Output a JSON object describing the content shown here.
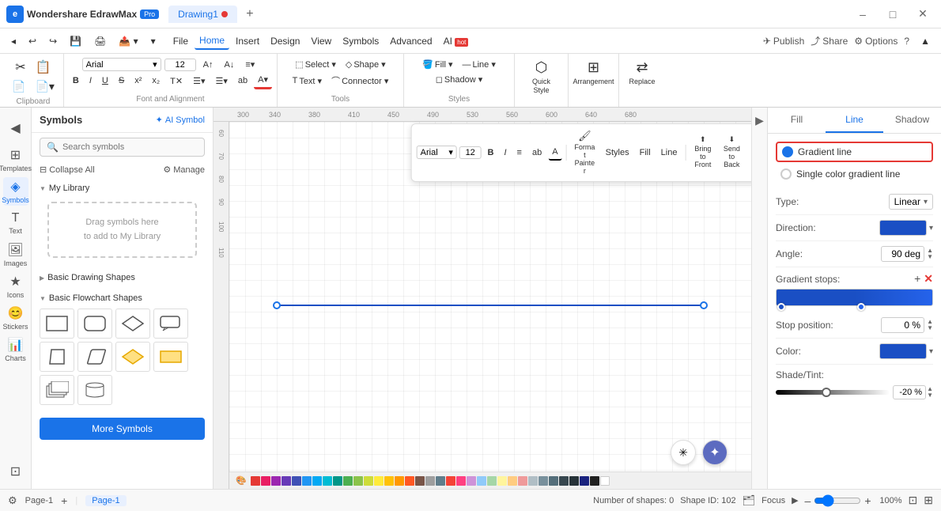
{
  "app": {
    "name": "Wondershare EdrawMax",
    "badge": "Pro",
    "tab1": "Drawing1",
    "tab1_dot": true
  },
  "titlebar": {
    "minimize": "–",
    "maximize": "□",
    "close": "✕"
  },
  "menubar": {
    "nav_back": "◂",
    "nav_forward": "▸",
    "file": "File",
    "tabs": [
      "Home",
      "Insert",
      "Design",
      "View",
      "Symbols",
      "Advanced",
      "AI"
    ],
    "ai_badge": "hot",
    "publish": "Publish",
    "share": "Share",
    "options": "Options"
  },
  "toolbar": {
    "font": "Arial",
    "font_size": "12",
    "select": "Select ▾",
    "shape": "Shape ▾",
    "fill": "Fill ▾",
    "line": "Line ▾",
    "shadow": "Shadow ▾",
    "text": "Text ▾",
    "connector": "Connector ▾",
    "quick_style": "Quick Style",
    "arrangement": "Arrangement",
    "replace": "Replace",
    "clipboard_label": "Clipboard",
    "font_align_label": "Font and Alignment",
    "tools_label": "Tools",
    "styles_label": "Styles",
    "bold": "B",
    "italic": "I",
    "underline": "U",
    "strikethrough": "S",
    "superscript": "x²",
    "subscript": "x₂",
    "format_painter": "Format Painter",
    "bring_to_front": "Bring to Front",
    "send_to_back": "Send to Back"
  },
  "symbols_panel": {
    "title": "Symbols",
    "ai_symbol": "AI Symbol",
    "search_placeholder": "Search symbols",
    "collapse_all": "Collapse All",
    "manage": "Manage",
    "my_library": "My Library",
    "drop_text": "Drag symbols here\nto add to My Library",
    "basic_drawing": "Basic Drawing Shapes",
    "basic_flowchart": "Basic Flowchart Shapes",
    "more_symbols": "More Symbols"
  },
  "canvas": {
    "number_of_shapes": "Number of shapes: 0",
    "shape_id": "Shape ID: 102",
    "page_name": "Page-1",
    "zoom": "100%"
  },
  "float_toolbar": {
    "font": "Arial",
    "font_size": "12",
    "bold": "B",
    "italic": "I",
    "align": "≡",
    "format": "ab",
    "font_color": "A",
    "format_painter": "Format Painter",
    "styles": "Styles",
    "fill": "Fill",
    "line": "Line",
    "bring_front": "Bring to Front",
    "send_back": "Send to Back"
  },
  "right_panel": {
    "tab_fill": "Fill",
    "tab_line": "Line",
    "tab_shadow": "Shadow",
    "active_tab": "Line",
    "gradient_line_label": "Gradient line",
    "single_color_label": "Single color gradient line",
    "type_label": "Type:",
    "type_value": "Linear",
    "direction_label": "Direction:",
    "angle_label": "Angle:",
    "angle_value": "90 deg",
    "gradient_stops_label": "Gradient stops:",
    "stop_position_label": "Stop position:",
    "stop_position_value": "0 %",
    "color_label": "Color:",
    "shade_tint_label": "Shade/Tint:",
    "shade_tint_value": "-20 %"
  },
  "statusbar": {
    "page_indicator": "Page-1",
    "add_page": "+",
    "shapes_info": "Number of shapes: 0",
    "shape_id": "Shape ID: 102",
    "focus": "Focus",
    "zoom_out": "–",
    "zoom_in": "+",
    "zoom_level": "100%",
    "fit": "⊡",
    "expand": "⊞"
  }
}
